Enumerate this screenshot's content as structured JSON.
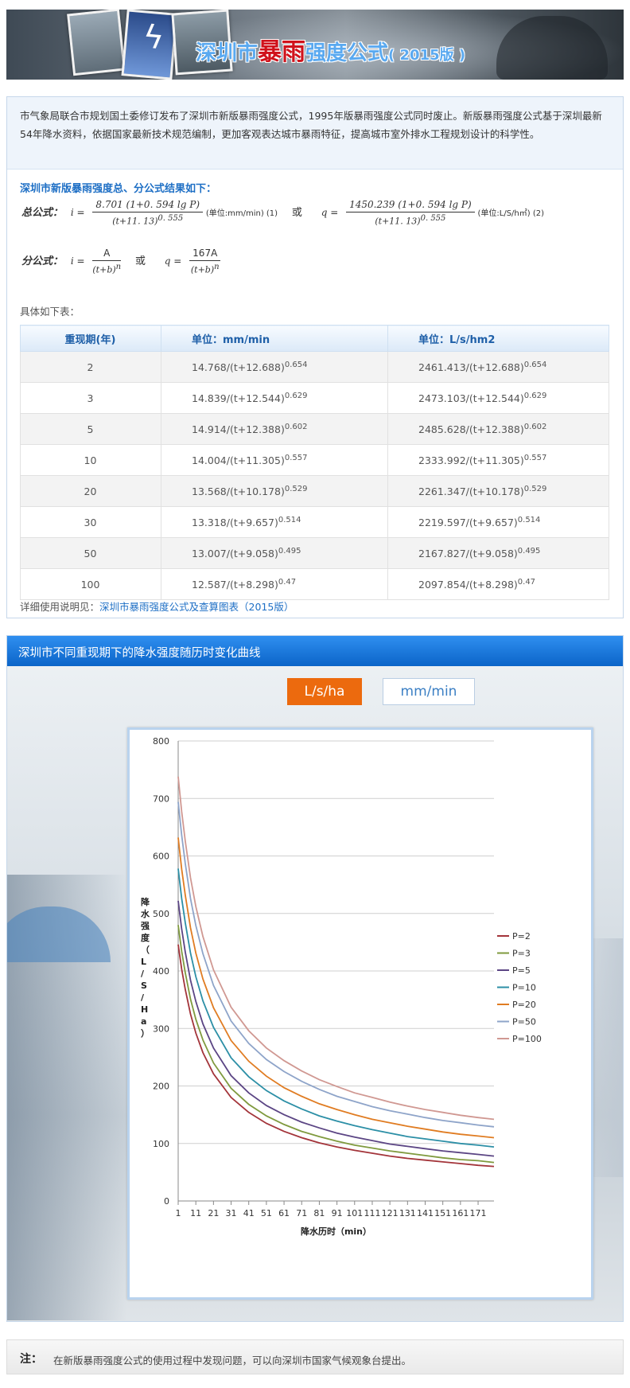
{
  "banner": {
    "title_a": "深圳市",
    "title_b": "暴雨",
    "title_c": "强度公式",
    "title_ver": "( 2015版 )"
  },
  "intro": "市气象局联合市规划国土委修订发布了深圳市新版暴雨强度公式，1995年版暴雨强度公式同时废止。新版暴雨强度公式基于深圳最新54年降水资料，依据国家最新技术规范编制，更加客观表达城市暴雨特征，提高城市室外排水工程规划设计的科学性。",
  "formulas": {
    "section_title": "深圳市新版暴雨强度总、分公式结果如下：",
    "total_label": "总公式：",
    "total_i_num": "8.701 (1+0. 594  lg  P)",
    "total_i_den": "(t+11. 13)",
    "total_i_exp": "0. 555",
    "total_i_unit": "(单位:mm/min)  (1)",
    "or": "或",
    "total_q_num": "1450.239 (1+0. 594  lg  P)",
    "total_q_den": "(t+11. 13)",
    "total_q_exp": "0. 555",
    "total_q_unit": "(单位:L/S/h㎡)  (2)",
    "sub_label": "分公式：",
    "sub_i_num": "A",
    "sub_i_den": "(t+b)",
    "sub_q_num": "167A",
    "sub_q_den": "(t+b)",
    "exp_n": "n",
    "i_eq": "i =",
    "q_eq": "q ="
  },
  "table_intro": "具体如下表：",
  "table": {
    "headers": [
      "重现期(年)",
      "单位：mm/min",
      "单位：L/s/hm2"
    ],
    "rows": [
      {
        "p": "2",
        "a": "14.768/(t+12.688)",
        "ae": "0.654",
        "b": "2461.413/(t+12.688)",
        "be": "0.654"
      },
      {
        "p": "3",
        "a": "14.839/(t+12.544)",
        "ae": "0.629",
        "b": "2473.103/(t+12.544)",
        "be": "0.629"
      },
      {
        "p": "5",
        "a": "14.914/(t+12.388)",
        "ae": "0.602",
        "b": "2485.628/(t+12.388)",
        "be": "0.602"
      },
      {
        "p": "10",
        "a": "14.004/(t+11.305)",
        "ae": "0.557",
        "b": "2333.992/(t+11.305)",
        "be": "0.557"
      },
      {
        "p": "20",
        "a": "13.568/(t+10.178)",
        "ae": "0.529",
        "b": "2261.347/(t+10.178)",
        "be": "0.529"
      },
      {
        "p": "30",
        "a": "13.318/(t+9.657)",
        "ae": "0.514",
        "b": "2219.597/(t+9.657)",
        "be": "0.514"
      },
      {
        "p": "50",
        "a": "13.007/(t+9.058)",
        "ae": "0.495",
        "b": "2167.827/(t+9.058)",
        "be": "0.495"
      },
      {
        "p": "100",
        "a": "12.587/(t+8.298)",
        "ae": "0.47",
        "b": "2097.854/(t+8.298)",
        "be": "0.47"
      }
    ]
  },
  "detail": {
    "prefix": "详细使用说明见：",
    "link": "深圳市暴雨强度公式及查算图表（2015版）"
  },
  "chart_section": {
    "title": "深圳市不同重现期下的降水强度随历时变化曲线",
    "unit_active": "L/s/ha",
    "unit_inactive": "mm/min"
  },
  "chart_data": {
    "type": "line",
    "title": "",
    "xlabel": "降水历时（min）",
    "ylabel": "降水强度（L/S/Ha）",
    "xlim": [
      1,
      180
    ],
    "ylim": [
      0,
      800
    ],
    "yticks": [
      0,
      100,
      200,
      300,
      400,
      500,
      600,
      700,
      800
    ],
    "xticks": [
      1,
      11,
      21,
      31,
      41,
      51,
      61,
      71,
      81,
      91,
      101,
      111,
      121,
      131,
      141,
      151,
      161,
      171
    ],
    "grid": true,
    "legend": "right",
    "x": [
      1,
      3,
      5,
      8,
      11,
      15,
      21,
      31,
      41,
      51,
      61,
      71,
      81,
      91,
      101,
      111,
      121,
      131,
      141,
      151,
      161,
      171,
      180
    ],
    "series": [
      {
        "name": "P=2",
        "color": "#a3343a",
        "values": [
          446,
          403,
          368,
          325,
          292,
          258,
          221,
          180,
          154,
          135,
          121,
          110,
          101,
          94,
          88,
          83,
          78,
          74,
          71,
          68,
          65,
          62,
          60
        ]
      },
      {
        "name": "P=3",
        "color": "#7f9a3e",
        "values": [
          480,
          434,
          397,
          351,
          316,
          280,
          240,
          196,
          168,
          148,
          133,
          121,
          112,
          104,
          97,
          92,
          87,
          83,
          79,
          75,
          72,
          70,
          67
        ]
      },
      {
        "name": "P=5",
        "color": "#5b4584",
        "values": [
          522,
          473,
          433,
          384,
          347,
          308,
          266,
          218,
          188,
          166,
          150,
          137,
          127,
          118,
          111,
          105,
          99,
          95,
          91,
          87,
          84,
          81,
          78
        ]
      },
      {
        "name": "P=10",
        "color": "#2c8fa6",
        "values": [
          578,
          526,
          484,
          431,
          390,
          348,
          302,
          249,
          216,
          192,
          174,
          160,
          148,
          139,
          131,
          124,
          118,
          112,
          108,
          104,
          100,
          97,
          94
        ]
      },
      {
        "name": "P=20",
        "color": "#e07c22",
        "values": [
          632,
          577,
          532,
          475,
          431,
          386,
          336,
          279,
          243,
          217,
          197,
          182,
          169,
          159,
          150,
          142,
          136,
          130,
          125,
          120,
          116,
          113,
          110
        ]
      },
      {
        "name": "P=50",
        "color": "#8ea4c9",
        "values": [
          694,
          636,
          587,
          526,
          479,
          430,
          375,
          313,
          274,
          246,
          225,
          208,
          194,
          182,
          173,
          164,
          157,
          151,
          145,
          140,
          136,
          132,
          129
        ]
      },
      {
        "name": "P=100",
        "color": "#d09892",
        "values": [
          738,
          677,
          626,
          562,
          512,
          460,
          402,
          337,
          296,
          266,
          244,
          226,
          211,
          199,
          188,
          180,
          172,
          165,
          159,
          154,
          149,
          145,
          142
        ]
      }
    ]
  },
  "footer": {
    "label": "注：",
    "text": "在新版暴雨强度公式的使用过程中发现问题，可以向深圳市国家气候观象台提出。"
  }
}
